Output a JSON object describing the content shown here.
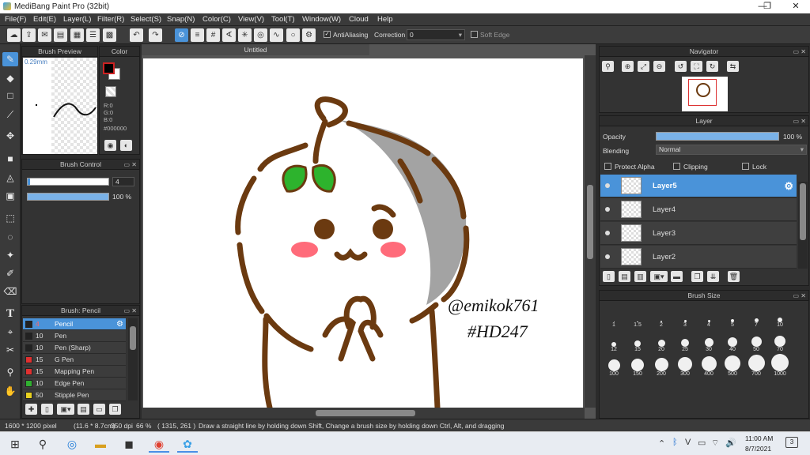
{
  "window": {
    "title": "MediBang Paint Pro (32bit)"
  },
  "menu": [
    "File(F)",
    "Edit(E)",
    "Layer(L)",
    "Filter(R)",
    "Select(S)",
    "Snap(N)",
    "Color(C)",
    "View(V)",
    "Tool(T)",
    "Window(W)",
    "Cloud",
    "Help"
  ],
  "toolbar": {
    "antialiasing_label": "AntiAliasing",
    "correction_label": "Correction",
    "correction_value": "0",
    "soft_edge_label": "Soft Edge"
  },
  "brush_preview": {
    "title": "Brush Preview",
    "size": "0.29mm"
  },
  "color_panel": {
    "title": "Color",
    "r": "R:0",
    "g": "G:0",
    "b": "B:0",
    "hex": "#000000",
    "fg_color": "#000000",
    "bg_color": "#ffffff"
  },
  "brush_control": {
    "title": "Brush Control",
    "size": "4",
    "opacity": "100 %"
  },
  "brush_list": {
    "title": "Brush: Pencil",
    "items": [
      {
        "size": "4",
        "name": "Pencil",
        "color": "#222222"
      },
      {
        "size": "10",
        "name": "Pen",
        "color": "#222222"
      },
      {
        "size": "10",
        "name": "Pen (Sharp)",
        "color": "#222222"
      },
      {
        "size": "15",
        "name": "G Pen",
        "color": "#e03030"
      },
      {
        "size": "15",
        "name": "Mapping Pen",
        "color": "#e03030"
      },
      {
        "size": "10",
        "name": "Edge Pen",
        "color": "#30b030"
      },
      {
        "size": "50",
        "name": "Stipple Pen",
        "color": "#e8d020"
      }
    ]
  },
  "canvas": {
    "tab": "Untitled",
    "signature": "@emikok761",
    "tag": "#HD247"
  },
  "navigator": {
    "title": "Navigator"
  },
  "layer_panel": {
    "title": "Layer",
    "opacity_label": "Opacity",
    "opacity_value": "100 %",
    "opacity_fraction": 1.0,
    "blending_label": "Blending",
    "blending_value": "Normal",
    "protect_alpha": "Protect Alpha",
    "clipping": "Clipping",
    "lock": "Lock",
    "layers": [
      "Layer5",
      "Layer4",
      "Layer3",
      "Layer2"
    ]
  },
  "brush_size": {
    "title": "Brush Size",
    "sizes": [
      "1",
      "1.5",
      "2",
      "3",
      "4",
      "5",
      "7",
      "10",
      "12",
      "15",
      "20",
      "25",
      "30",
      "40",
      "50",
      "70",
      "100",
      "150",
      "200",
      "300",
      "400",
      "500",
      "700",
      "1000"
    ]
  },
  "status": {
    "dims": "1600 * 1200 pixel",
    "phys": "(11.6 * 8.7cm)",
    "dpi": "350 dpi",
    "zoom": "66 %",
    "coords": "( 1315, 261 )",
    "hint": "Draw a straight line by holding down Shift, Change a brush size by holding down Ctrl, Alt, and dragging"
  },
  "taskbar": {
    "time": "11:00 AM",
    "date": "8/7/2021",
    "notifications": "3"
  }
}
